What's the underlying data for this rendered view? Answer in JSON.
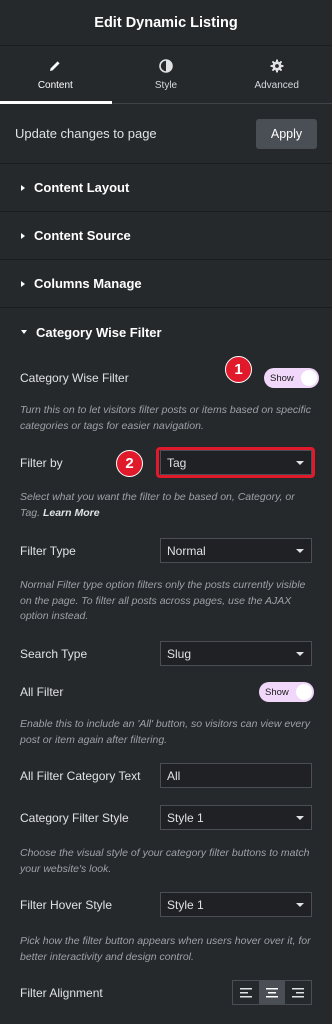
{
  "header": {
    "title": "Edit Dynamic Listing"
  },
  "tabs": [
    {
      "label": "Content",
      "icon": "pencil-icon",
      "active": true
    },
    {
      "label": "Style",
      "icon": "contrast-icon",
      "active": false
    },
    {
      "label": "Advanced",
      "icon": "gear-icon",
      "active": false
    }
  ],
  "update": {
    "text": "Update changes to page",
    "apply_label": "Apply"
  },
  "sections": [
    {
      "label": "Content Layout",
      "expanded": false
    },
    {
      "label": "Content Source",
      "expanded": false
    },
    {
      "label": "Columns Manage",
      "expanded": false
    },
    {
      "label": "Category Wise Filter",
      "expanded": true
    }
  ],
  "controls": {
    "category_wise_filter": {
      "label": "Category Wise Filter",
      "toggle": "Show",
      "desc": "Turn this on to let visitors filter posts or items based on specific categories or tags for easier navigation."
    },
    "filter_by": {
      "label": "Filter by",
      "value": "Tag",
      "desc": "Select what you want the filter to be based on, Category, or Tag.",
      "learn_more": "Learn More"
    },
    "filter_type": {
      "label": "Filter Type",
      "value": "Normal",
      "desc": "Normal Filter type option filters only the posts currently visible on the page. To filter all posts across pages, use the AJAX option instead."
    },
    "search_type": {
      "label": "Search Type",
      "value": "Slug"
    },
    "all_filter": {
      "label": "All Filter",
      "toggle": "Show",
      "desc": "Enable this to include an 'All' button, so visitors can view every post or item again after filtering."
    },
    "all_filter_text": {
      "label": "All Filter Category Text",
      "value": "All"
    },
    "category_filter_style": {
      "label": "Category Filter Style",
      "value": "Style 1",
      "desc": "Choose the visual style of your category filter buttons to match your website's look."
    },
    "filter_hover_style": {
      "label": "Filter Hover Style",
      "value": "Style 1",
      "desc": "Pick how the filter button appears when users hover over it, for better interactivity and design control."
    },
    "filter_alignment": {
      "label": "Filter Alignment",
      "options": [
        "align-left-icon",
        "align-center-icon",
        "align-right-icon"
      ],
      "selected": "align-center-icon"
    }
  },
  "annotations": {
    "badge_1": "1",
    "badge_2": "2",
    "highlight_color": "#e11a2b"
  },
  "colors": {
    "panel_bg": "#26292c",
    "toggle_on": "#f1d7fa",
    "input_bg": "#1f2124"
  }
}
